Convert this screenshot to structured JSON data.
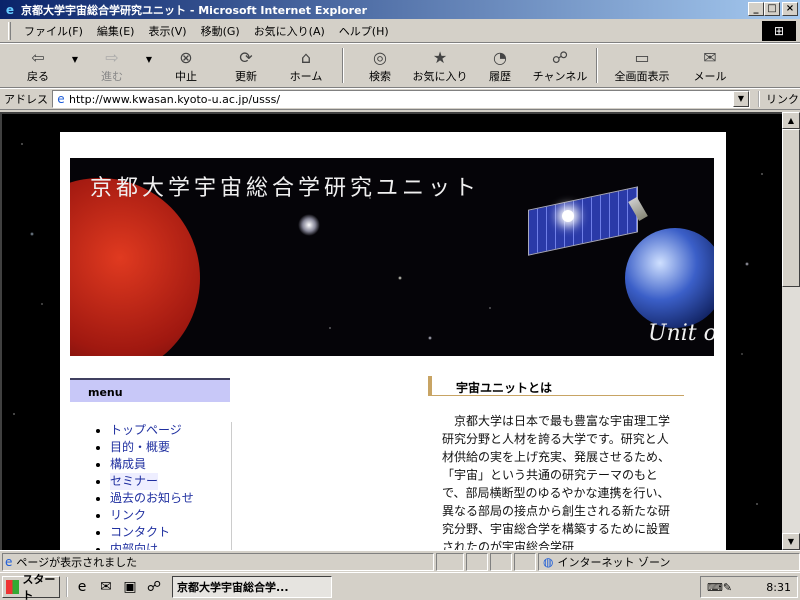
{
  "window": {
    "title": "京都大学宇宙総合学研究ユニット - Microsoft Internet Explorer",
    "buttons": {
      "minimize": "_",
      "maximize": "□",
      "close": "×"
    }
  },
  "menubar": {
    "items": [
      "ファイル(F)",
      "編集(E)",
      "表示(V)",
      "移動(G)",
      "お気に入り(A)",
      "ヘルプ(H)"
    ]
  },
  "toolbar": {
    "back": "戻る",
    "forward": "進む",
    "stop": "中止",
    "refresh": "更新",
    "home": "ホーム",
    "search": "検索",
    "favorites": "お気に入り",
    "history": "履歴",
    "channels": "チャンネル",
    "fullscreen": "全画面表示",
    "mail": "メール"
  },
  "address": {
    "label": "アドレス",
    "url": "http://www.kwasan.kyoto-u.ac.jp/usss/",
    "links": "リンク"
  },
  "page": {
    "banner_title": "京都大学宇宙総合学研究ユニット",
    "banner_subtitle": "Unit of",
    "menu_heading": "menu",
    "menu_items": [
      "トップページ",
      "目的・概要",
      "構成員",
      "セミナー",
      "過去のお知らせ",
      "リンク",
      "コンタクト",
      "内部向け"
    ],
    "section_heading": "宇宙ユニットとは",
    "section_text": "京都大学は日本で最も豊富な宇宙理工学研究分野と人材を誇る大学です。研究と人材供給の実を上げ充実、発展させるため、「宇宙」という共通の研究テーマのもとで、部局横断型のゆるやかな連携を行い、異なる部局の接点から創生される新たな研究分野、宇宙総合学を構築するために設置されたのが宇宙総合学研"
  },
  "statusbar": {
    "message": "ページが表示されました",
    "zone": "インターネット ゾーン"
  },
  "taskbar": {
    "start": "スタート",
    "task_title": "京都大学宇宙総合学...",
    "clock": "8:31"
  }
}
